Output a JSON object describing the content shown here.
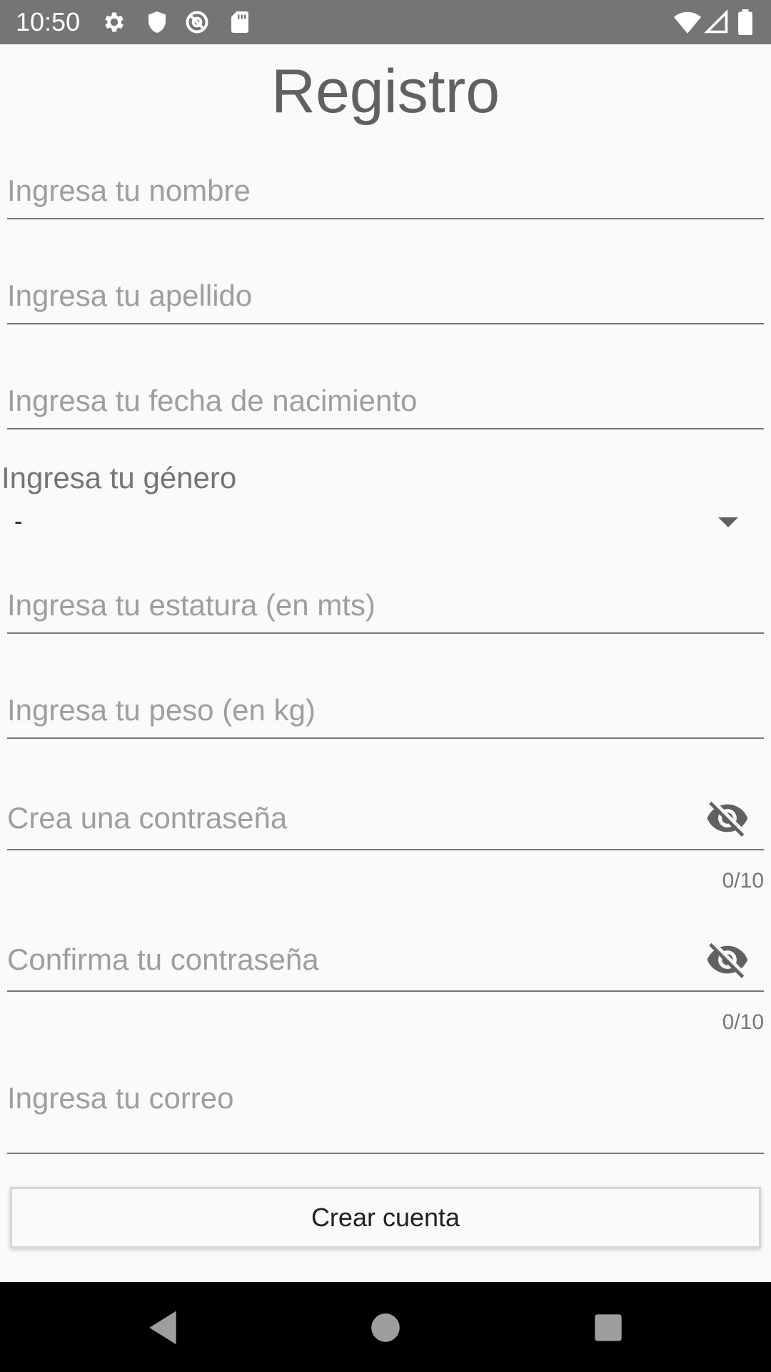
{
  "status_bar": {
    "time": "10:50",
    "icons": [
      "settings-icon",
      "shield-icon",
      "at-sign-icon",
      "sd-card-icon",
      "wifi-icon",
      "cell-signal-icon",
      "battery-icon"
    ]
  },
  "form": {
    "title": "Registro",
    "name_hint": "Ingresa tu nombre",
    "lastname_hint": "Ingresa tu apellido",
    "birthdate_hint": "Ingresa tu fecha de nacimiento",
    "gender_label": "Ingresa tu género",
    "gender_value": "-",
    "height_hint": "Ingresa tu estatura (en mts)",
    "weight_hint": "Ingresa tu peso (en kg)",
    "password_hint": "Crea una contraseña",
    "password_counter": "0/10",
    "confirm_password_hint": "Confirma tu contraseña",
    "confirm_password_counter": "0/10",
    "email_hint": "Ingresa tu correo",
    "create_button": "Crear cuenta"
  },
  "nav_bar": {
    "icons": [
      "back-icon",
      "home-icon",
      "recents-icon"
    ]
  },
  "colors": {
    "status_bar": "#757575",
    "background": "#fafafa",
    "hint_text": "#9e9e9e",
    "underline": "#757575",
    "nav_bar": "#000000"
  }
}
